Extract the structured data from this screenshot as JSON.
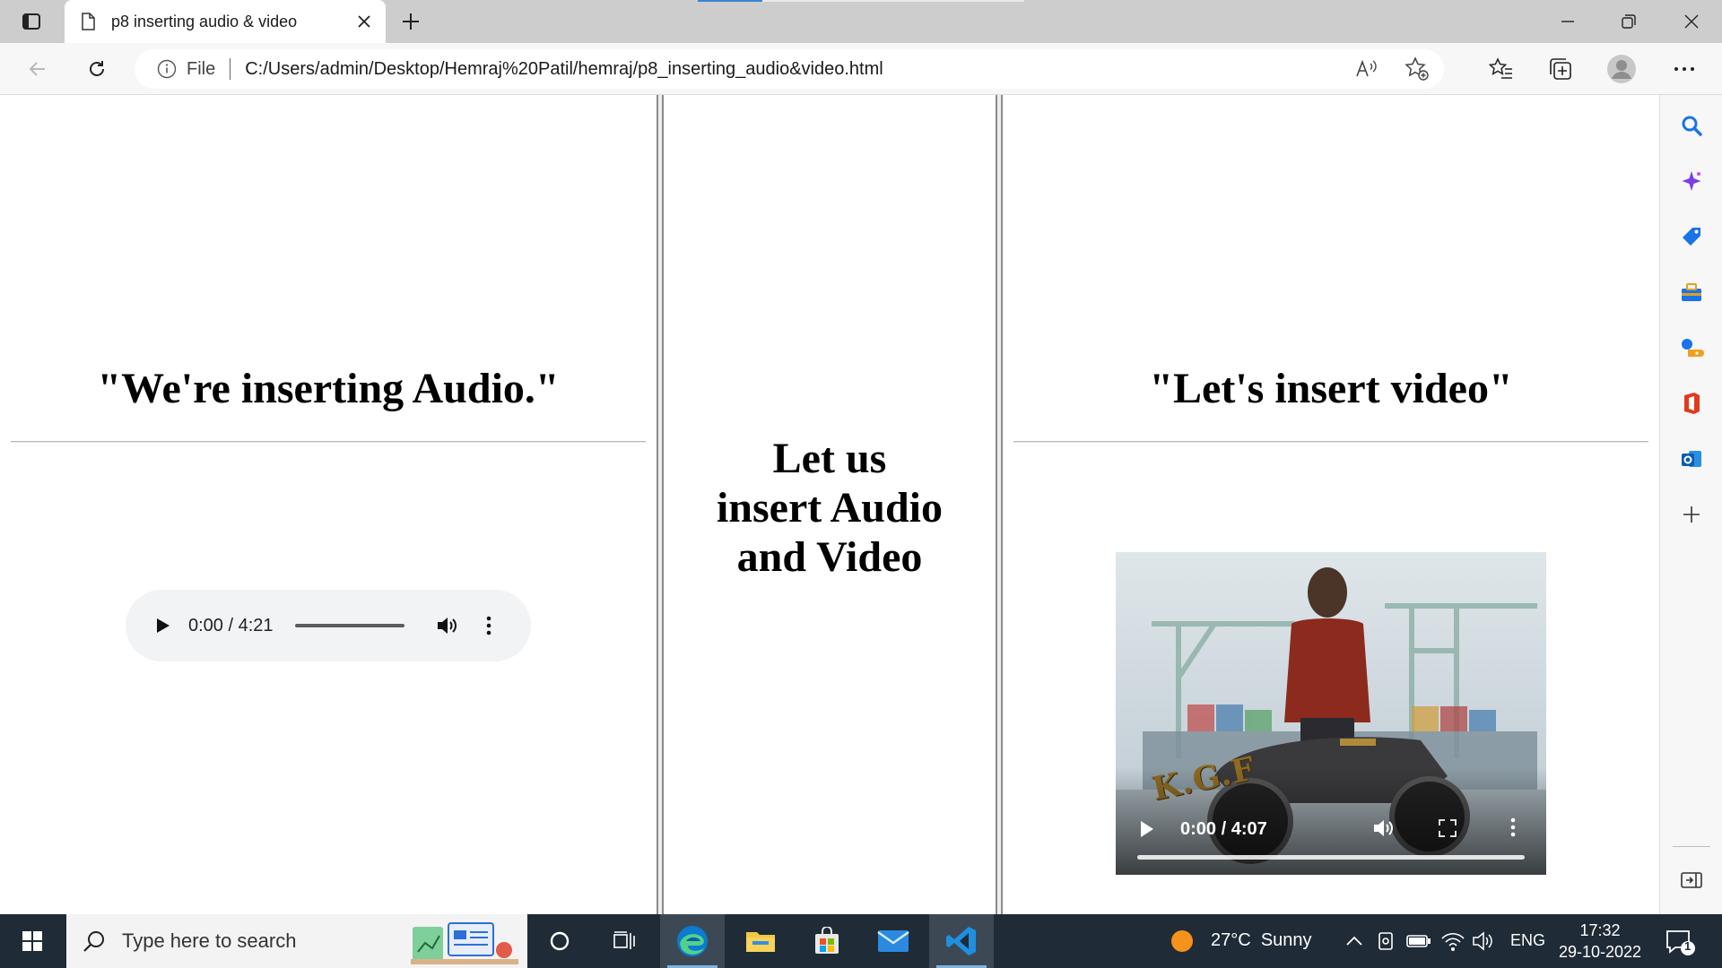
{
  "browser": {
    "tab": {
      "title": "p8 inserting audio & video"
    },
    "address": {
      "file_label": "File",
      "url": "C:/Users/admin/Desktop/Hemraj%20Patil/hemraj/p8_inserting_audio&video.html"
    }
  },
  "page": {
    "left_frame": {
      "heading": "\"We're inserting Audio.\"",
      "audio": {
        "time": "0:00 / 4:21"
      }
    },
    "middle_frame": {
      "heading_lines": [
        "Let us",
        "insert Audio",
        "and Video"
      ]
    },
    "right_frame": {
      "heading": "\"Let's insert video\"",
      "video": {
        "time": "0:00 / 4:07",
        "poster_text": "K.G.F"
      }
    }
  },
  "taskbar": {
    "search_placeholder": "Type here to search",
    "weather": {
      "temp": "27°C",
      "condition": "Sunny"
    },
    "language": "ENG",
    "clock": {
      "time": "17:32",
      "date": "29-10-2022"
    },
    "notifications": "1"
  },
  "colors": {
    "accent": "#0078d4",
    "taskbar": "#1f2b36",
    "frame_border": "#8a8a8a"
  }
}
